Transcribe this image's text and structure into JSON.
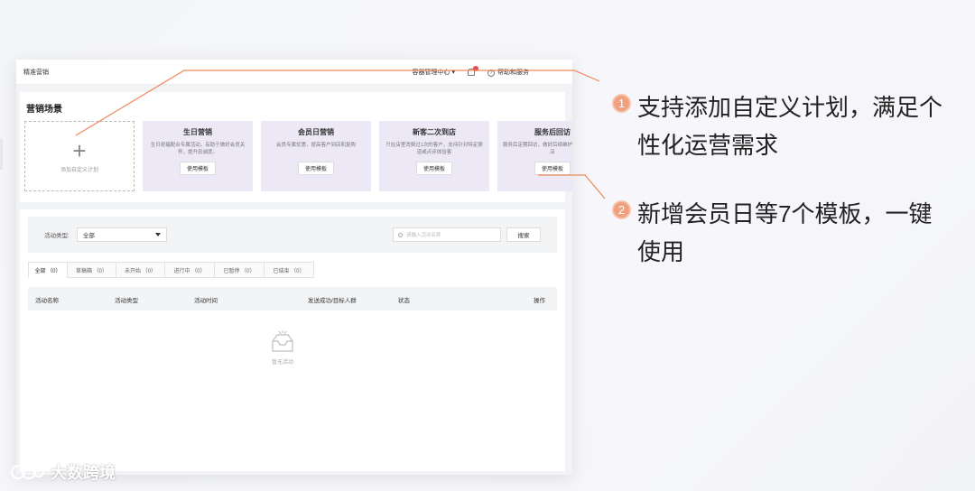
{
  "app": {
    "title": "精准营销",
    "nav": {
      "store": "容器管理中心",
      "help": "帮助和服务"
    }
  },
  "scenes": {
    "title": "营销场景",
    "custom_label": "添加自定义计划",
    "cards": [
      {
        "title": "生日营销",
        "desc": "生日祝福配合专属活动，有助于做好会员关怀，提升忠诚度。",
        "button": "使用模板"
      },
      {
        "title": "会员日营销",
        "desc": "会员专属优惠，提高客户到店和复购",
        "button": "使用模板"
      },
      {
        "title": "新客二次到店",
        "desc": "只在店里消费过1次的客户，支持针对特定渠道或点评体验客",
        "button": "使用模板"
      },
      {
        "title": "服务后回访",
        "desc": "服务后定期回访，做好后续维护，促进多次到店",
        "button": "使用模板"
      }
    ]
  },
  "filter": {
    "type_label": "活动类型:",
    "type_value": "全部",
    "search_placeholder": "请输入活动名称",
    "search_button": "搜索"
  },
  "tabs": [
    "全部 （0）",
    "草稿箱 （0）",
    "未开始 （0）",
    "进行中 （0）",
    "已暂停 （0）",
    "已结束 （0）"
  ],
  "table": {
    "columns": [
      "活动名称",
      "活动类型",
      "活动时间",
      "发送成功/目标人群",
      "状态",
      "操作"
    ]
  },
  "empty_text": "暂无活动",
  "callouts": [
    {
      "num": "1",
      "text": "支持添加自定义计划，满足个性化运营需求"
    },
    {
      "num": "2",
      "text": "新增会员日等7个模板，一键使用"
    }
  ],
  "watermark": "大数跨境",
  "colors": {
    "accent": "#f0a07e",
    "card_bg": "#ece8f6",
    "line": "#f0875a"
  }
}
